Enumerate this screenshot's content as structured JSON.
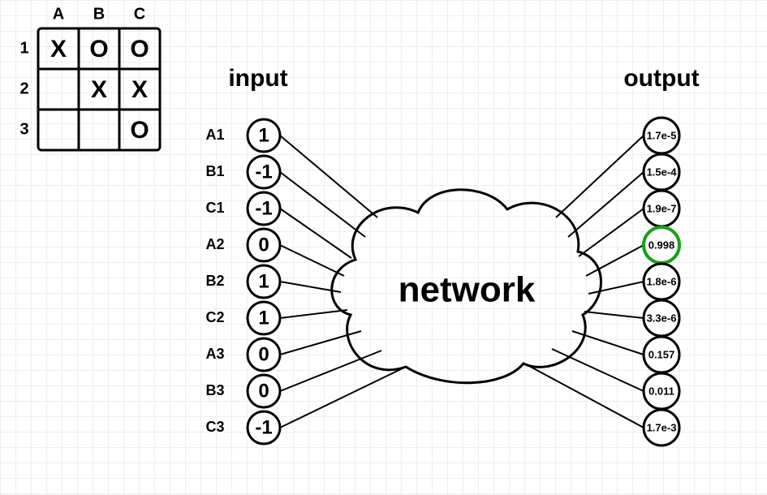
{
  "board": {
    "cols": [
      "A",
      "B",
      "C"
    ],
    "rows": [
      "1",
      "2",
      "3"
    ],
    "cells": {
      "A1": "X",
      "B1": "O",
      "C1": "O",
      "A2": "",
      "B2": "X",
      "C2": "X",
      "A3": "",
      "B3": "",
      "C3": "O"
    }
  },
  "headings": {
    "input": "input",
    "output": "output",
    "network": "network"
  },
  "inputs": [
    {
      "label": "A1",
      "value": "1"
    },
    {
      "label": "B1",
      "value": "-1"
    },
    {
      "label": "C1",
      "value": "-1"
    },
    {
      "label": "A2",
      "value": "0"
    },
    {
      "label": "B2",
      "value": "1"
    },
    {
      "label": "C2",
      "value": "1"
    },
    {
      "label": "A3",
      "value": "0"
    },
    {
      "label": "B3",
      "value": "0"
    },
    {
      "label": "C3",
      "value": "-1"
    }
  ],
  "outputs": [
    {
      "value": "1.7e-5",
      "highlight": false
    },
    {
      "value": "1.5e-4",
      "highlight": false
    },
    {
      "value": "1.9e-7",
      "highlight": false
    },
    {
      "value": "0.998",
      "highlight": true
    },
    {
      "value": "1.8e-6",
      "highlight": false
    },
    {
      "value": "3.3e-6",
      "highlight": false
    },
    {
      "value": "0.157",
      "highlight": false
    },
    {
      "value": "0.011",
      "highlight": false
    },
    {
      "value": "1.7e-3",
      "highlight": false
    }
  ]
}
